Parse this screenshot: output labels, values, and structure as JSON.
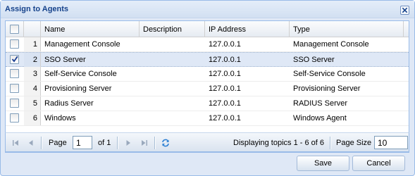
{
  "dialog": {
    "title": "Assign to Agents"
  },
  "grid": {
    "columns": {
      "name": "Name",
      "description": "Description",
      "ip": "IP Address",
      "type": "Type"
    },
    "rows": [
      {
        "num": "1",
        "name": "Management Console",
        "description": "",
        "ip": "127.0.0.1",
        "type": "Management Console",
        "checked": false
      },
      {
        "num": "2",
        "name": "SSO Server",
        "description": "",
        "ip": "127.0.0.1",
        "type": "SSO Server",
        "checked": true
      },
      {
        "num": "3",
        "name": "Self-Service Console",
        "description": "",
        "ip": "127.0.0.1",
        "type": "Self-Service Console",
        "checked": false
      },
      {
        "num": "4",
        "name": "Provisioning Server",
        "description": "",
        "ip": "127.0.0.1",
        "type": "Provisioning Server",
        "checked": false
      },
      {
        "num": "5",
        "name": "Radius Server",
        "description": "",
        "ip": "127.0.0.1",
        "type": "RADIUS Server",
        "checked": false
      },
      {
        "num": "6",
        "name": "Windows",
        "description": "",
        "ip": "127.0.0.1",
        "type": "Windows Agent",
        "checked": false
      }
    ]
  },
  "pager": {
    "page_label": "Page",
    "page_value": "1",
    "of_label": "of 1",
    "display_text": "Displaying topics 1 - 6 of 6",
    "page_size_label": "Page Size",
    "page_size_value": "10",
    "icons": [
      "first-page-icon",
      "prev-page-icon",
      "next-page-icon",
      "last-page-icon",
      "refresh-icon"
    ]
  },
  "buttons": {
    "save": "Save",
    "cancel": "Cancel"
  },
  "colors": {
    "title_text": "#15428b",
    "border": "#99bbe8",
    "selected_row": "#dfe8f6"
  }
}
